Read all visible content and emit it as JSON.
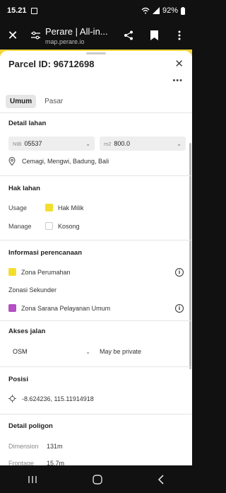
{
  "status_bar": {
    "time": "15.21",
    "battery": "92%"
  },
  "browser": {
    "title": "Perare | All-in...",
    "url": "map.perare.io"
  },
  "panel": {
    "title": "Parcel ID: 96712698",
    "tabs": [
      "Umum",
      "Pasar"
    ],
    "detail_lahan": {
      "title": "Detail lahan",
      "nib_prefix": "NIB",
      "nib_value": "05537",
      "area_prefix": "m2",
      "area_value": "800.0",
      "location": "Cemagi, Mengwi, Badung, Bali"
    },
    "hak_lahan": {
      "title": "Hak lahan",
      "usage_label": "Usage",
      "usage_value": "Hak Milik",
      "usage_color": "#f3de2c",
      "manage_label": "Manage",
      "manage_value": "Kosong"
    },
    "perencanaan": {
      "title": "Informasi perencanaan",
      "zona_utama": "Zona Perumahan",
      "zona_utama_color": "#f3de2c",
      "sekunder_label": "Zonasi Sekunder",
      "zona_sekunder": "Zona Sarana Pelayanan Umum",
      "zona_sekunder_color": "#b44fc4"
    },
    "akses": {
      "title": "Akses jalan",
      "source": "OSM",
      "note": "May be private"
    },
    "posisi": {
      "title": "Posisi",
      "coords": "-8.624236, 115.11914918"
    },
    "poligon": {
      "title": "Detail poligon",
      "dimension_label": "Dimension",
      "dimension_value": "131m",
      "frontage_label": "Frontage",
      "frontage_value": "15.7m"
    }
  }
}
